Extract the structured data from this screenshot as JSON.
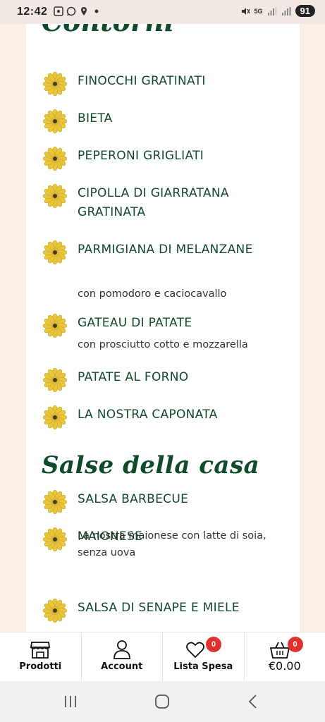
{
  "status_bar": {
    "time": "12:42",
    "battery": "91",
    "network": "5G"
  },
  "menu": {
    "partial_heading": "Contorni",
    "contorni": [
      {
        "name": "FINOCCHI GRATINATI",
        "desc": ""
      },
      {
        "name": "BIETA",
        "desc": ""
      },
      {
        "name": "PEPERONI GRIGLIATI",
        "desc": ""
      },
      {
        "name": "CIPOLLA DI GIARRATANA GRATINATA",
        "desc": ""
      },
      {
        "name": "PARMIGIANA DI MELANZANE",
        "desc": "con pomodoro e caciocavallo"
      },
      {
        "name": "GATEAU DI PATATE",
        "desc": "con prosciutto cotto e mozzarella"
      },
      {
        "name": "PATATE AL FORNO",
        "desc": ""
      },
      {
        "name": "LA NOSTRA CAPONATA",
        "desc": ""
      }
    ],
    "salse_heading": "Salse della casa",
    "salse": [
      {
        "name": "SALSA BARBECUE",
        "desc": ""
      },
      {
        "name": "MAIONESE",
        "desc": "La nostra maionese con latte di soia, senza uova"
      },
      {
        "name": "SALSA DI SENAPE E MIELE",
        "desc": ""
      }
    ]
  },
  "bottom_nav": {
    "prodotti": "Prodotti",
    "account": "Account",
    "lista_spesa": "Lista Spesa",
    "lista_badge": "0",
    "cart_total": "€0.00",
    "cart_badge": "0"
  },
  "colors": {
    "heading_green": "#0f4a2a",
    "flower_yellow": "#e8c53a",
    "badge_red": "#e03131",
    "page_bg": "#fbf0e6"
  }
}
